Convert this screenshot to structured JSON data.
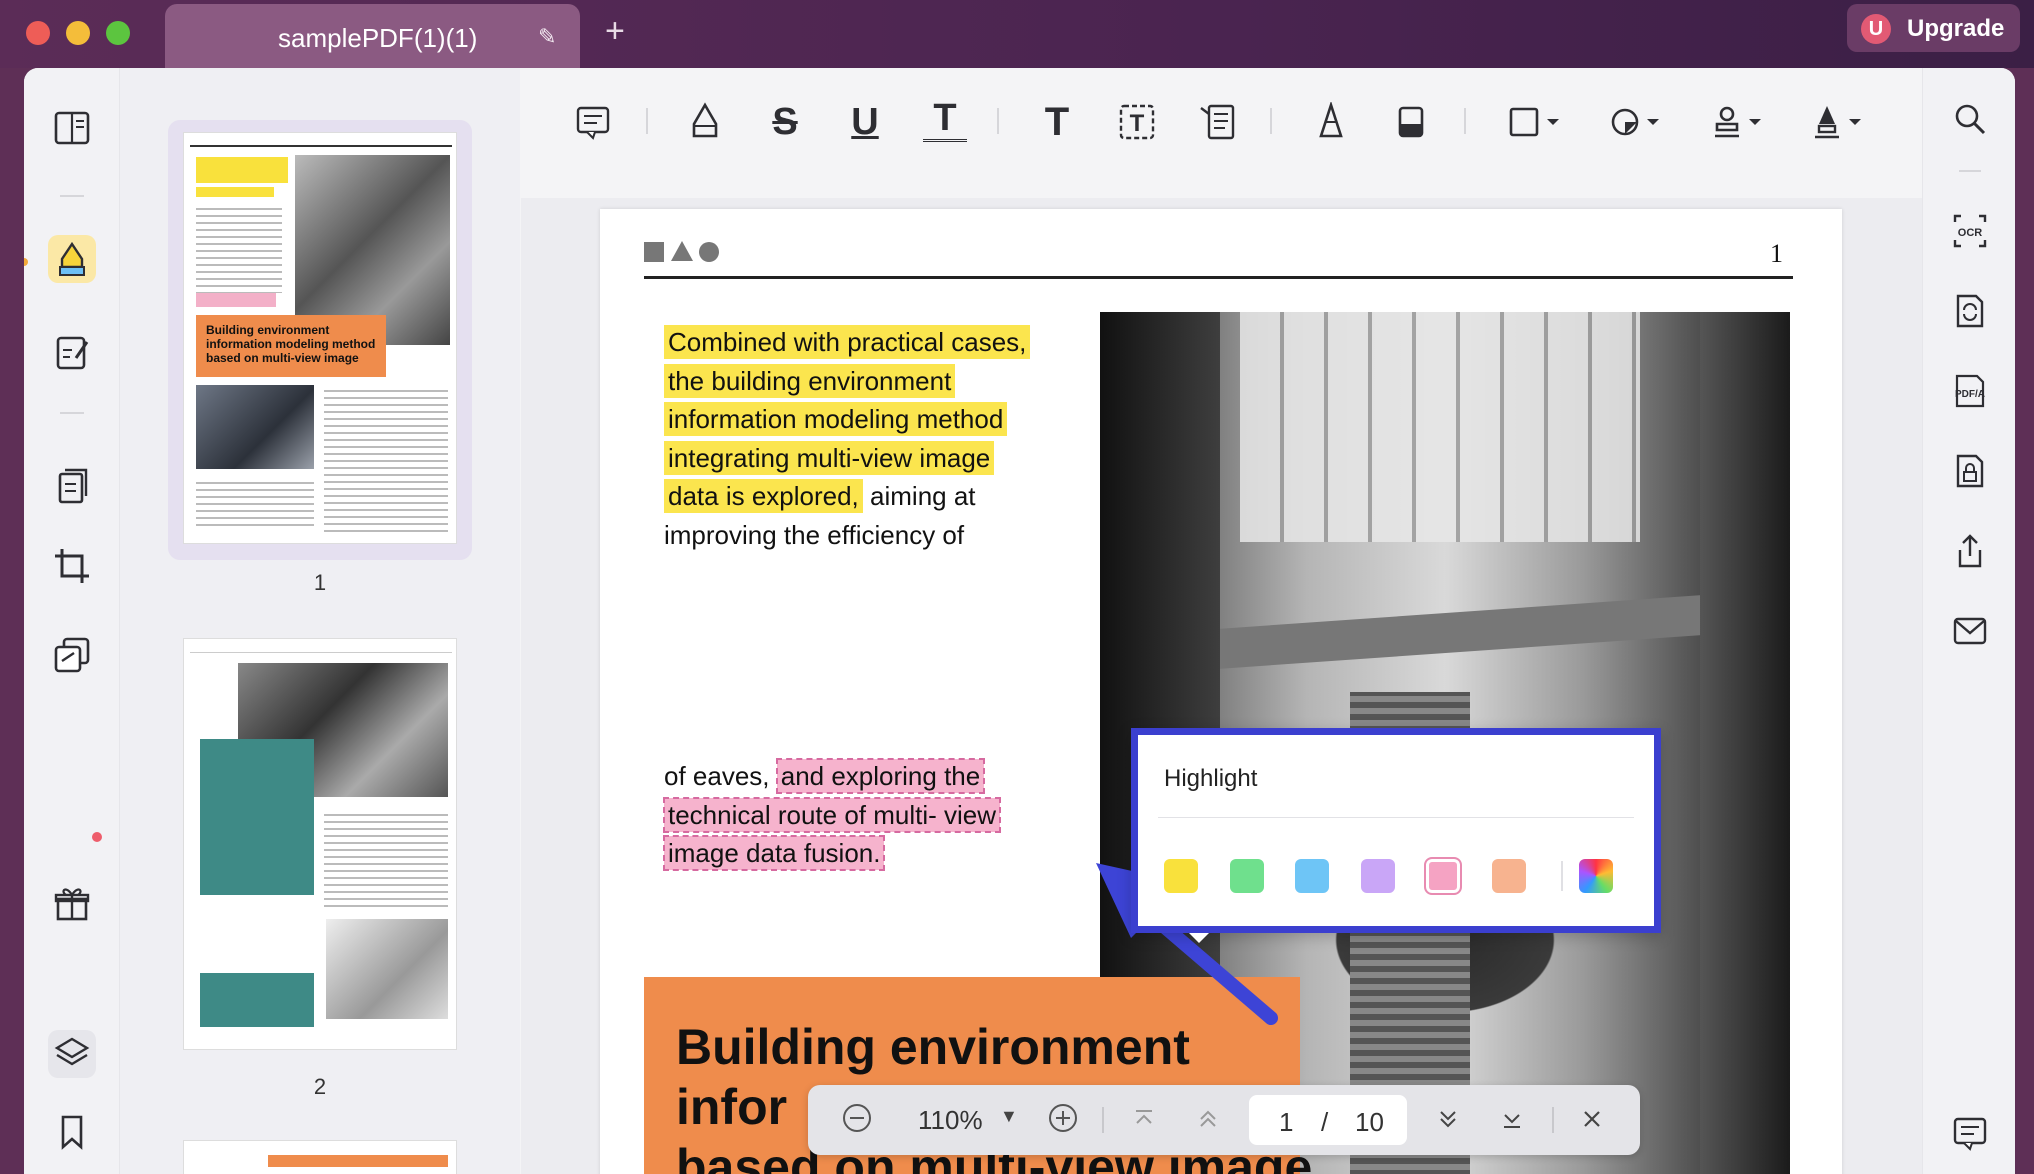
{
  "window": {
    "tab_title": "samplePDF(1)(1)",
    "upgrade_label": "Upgrade",
    "avatar_letter": "U"
  },
  "thumbnails": [
    {
      "page_label": "1",
      "heading": "Building environment information modeling method based on multi-view image"
    },
    {
      "page_label": "2"
    }
  ],
  "page": {
    "number": "1",
    "highlight_lines": [
      "Combined with practical cases,",
      "the building environment",
      "information modeling method",
      "integrating multi-view image",
      "data is explored,"
    ],
    "after_highlight": " aiming at",
    "cut_line": "improving the efficiency of",
    "lower_prefix": "of eaves, ",
    "pink_lines": [
      "and exploring the",
      "technical route of multi- view",
      "image data fusion."
    ],
    "heading_lines": [
      "Building environment",
      "infor",
      "based on multi-view image"
    ]
  },
  "popup": {
    "title": "Highlight",
    "colors": [
      "#f9e13c",
      "#6fe08d",
      "#6ec5f6",
      "#c9a6f7",
      "#f5a3c3",
      "#f7b38f"
    ]
  },
  "zoom": {
    "level": "110%",
    "current_page": "1",
    "separator": "/",
    "total_pages": "10"
  }
}
